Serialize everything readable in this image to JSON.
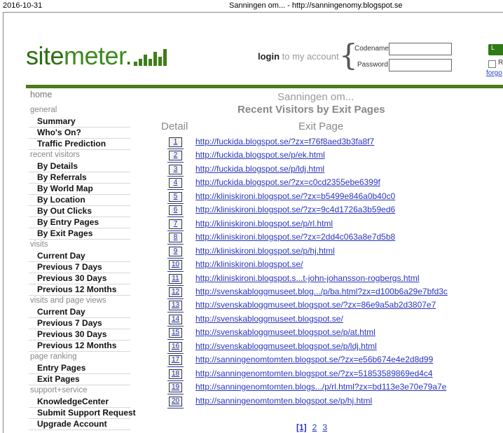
{
  "print_header": {
    "date": "2016-10-31",
    "page_title": "Sanningen om... - http://sanningenomy.blogspot.se"
  },
  "brand": {
    "logo_text_1": "site",
    "logo_text_2": "meter",
    "logo_dot": ".",
    "accent": "#3d7f16"
  },
  "login": {
    "login_bold": "login",
    "login_rest": " to my account",
    "codename_label": "Codename",
    "password_label": "Password",
    "codename_value": "",
    "password_value": "",
    "button_label": "L",
    "remember_label": "R",
    "forgot_link": "forgo"
  },
  "sidebar": {
    "home": "home",
    "sections": [
      {
        "heading": "general",
        "items": [
          "Summary",
          "Who's On?",
          "Traffic Prediction"
        ]
      },
      {
        "heading": "recent visitors",
        "items": [
          "By Details",
          "By Referrals",
          "By World Map",
          "By Location",
          "By Out Clicks",
          "By Entry Pages",
          "By Exit Pages"
        ]
      },
      {
        "heading": "visits",
        "items": [
          "Current Day",
          "Previous 7 Days",
          "Previous 30 Days",
          "Previous 12 Months"
        ]
      },
      {
        "heading": "visits and page views",
        "items": [
          "Current Day",
          "Previous 7 Days",
          "Previous 30 Days",
          "Previous 12 Months"
        ]
      },
      {
        "heading": "page ranking",
        "items": [
          "Entry Pages",
          "Exit Pages"
        ]
      },
      {
        "heading": "support+service",
        "items": [
          "KnowledgeCenter",
          "Submit Support Request",
          "Upgrade Account"
        ]
      }
    ]
  },
  "report": {
    "site_name": "Sanningen om...",
    "title": "Recent Visitors by Exit Pages",
    "col_detail": "Detail",
    "col_exit": "Exit Page",
    "rows": [
      {
        "n": "1",
        "url": "http://fuckida.blogspot.se/?zx=f76f8aed3b3fa8f7"
      },
      {
        "n": "2",
        "url": "http://fuckida.blogspot.se/p/ek.html"
      },
      {
        "n": "3",
        "url": "http://fuckida.blogspot.se/p/ldj.html"
      },
      {
        "n": "4",
        "url": "http://fuckida.blogspot.se/?zx=c0cd2355ebe6399f"
      },
      {
        "n": "5",
        "url": "http://kliniskironi.blogspot.se/?zx=b5499e846a0b40c0"
      },
      {
        "n": "6",
        "url": "http://kliniskironi.blogspot.se/?zx=9c4d1726a3b59ed6"
      },
      {
        "n": "7",
        "url": "http://kliniskironi.blogspot.se/p/rl.html"
      },
      {
        "n": "8",
        "url": "http://kliniskironi.blogspot.se/?zx=2dd4c063a8e7d5b8"
      },
      {
        "n": "9",
        "url": "http://kliniskironi.blogspot.se/p/hj.html"
      },
      {
        "n": "10",
        "url": "http://kliniskironi.blogspot.se/"
      },
      {
        "n": "11",
        "url": "http://kliniskironi.blogspot.s...t-john-johansson-rogbergs.html"
      },
      {
        "n": "12",
        "url": "http://svenskabloggmuseet.blog.../p/ba.html?zx=d100b6a29e7bfd3c"
      },
      {
        "n": "13",
        "url": "http://svenskabloggmuseet.blogspot.se/?zx=86e9a5ab2d3807e7"
      },
      {
        "n": "14",
        "url": "http://svenskabloggmuseet.blogspot.se/"
      },
      {
        "n": "15",
        "url": "http://svenskabloggmuseet.blogspot.se/p/at.html"
      },
      {
        "n": "16",
        "url": "http://svenskabloggmuseet.blogspot.se/p/ldj.html"
      },
      {
        "n": "17",
        "url": "http://sanningenomtomten.blogspot.se/?zx=e56b674e4e2d8d99"
      },
      {
        "n": "18",
        "url": "http://sanningenomtomten.blogspot.se/?zx=51853589869ed4c4"
      },
      {
        "n": "19",
        "url": "http://sanningenomtomten.blogs.../p/rl.html?zx=bd113e3e70e79a7e"
      },
      {
        "n": "20",
        "url": "http://sanningenomtomten.blogspot.se/p/hj.html"
      }
    ],
    "pager": [
      "[1]",
      "2",
      "3"
    ]
  }
}
